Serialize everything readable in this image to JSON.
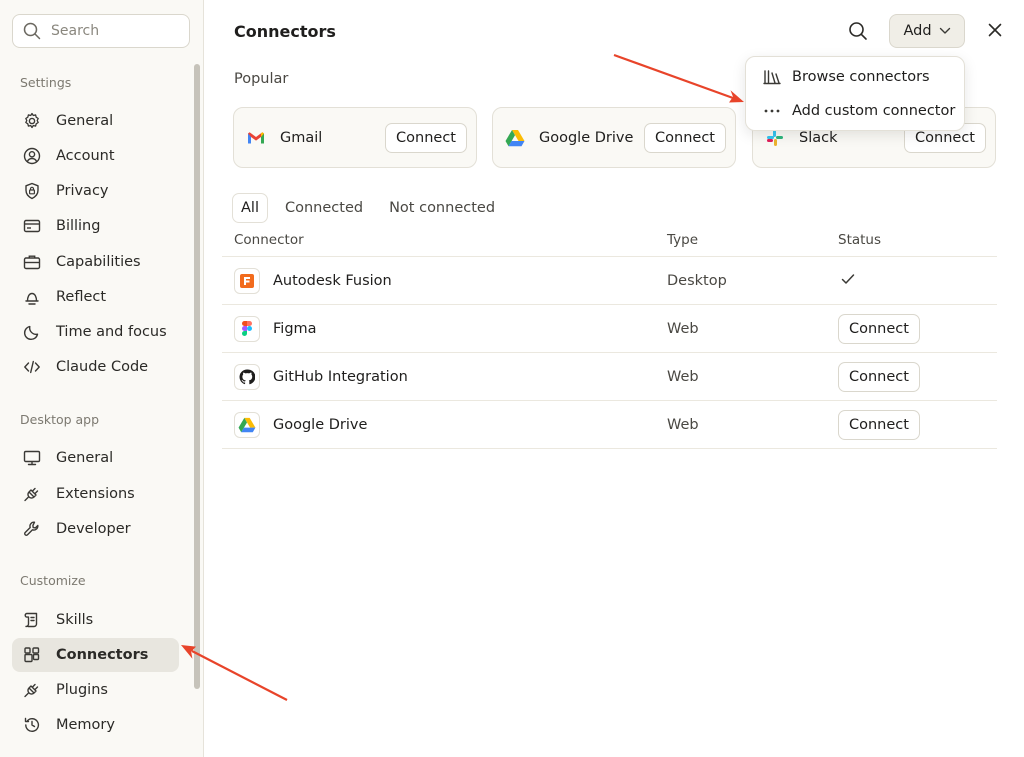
{
  "sidebar": {
    "search_placeholder": "Search",
    "sections": {
      "settings": "Settings",
      "desktop": "Desktop app",
      "customize": "Customize"
    },
    "settings_items": [
      {
        "label": "General",
        "icon": "gear-icon"
      },
      {
        "label": "Account",
        "icon": "user-circle-icon"
      },
      {
        "label": "Privacy",
        "icon": "shield-lock-icon"
      },
      {
        "label": "Billing",
        "icon": "credit-card-icon"
      },
      {
        "label": "Capabilities",
        "icon": "briefcase-icon"
      },
      {
        "label": "Reflect",
        "icon": "bell-icon"
      },
      {
        "label": "Time and focus",
        "icon": "moon-icon"
      },
      {
        "label": "Claude Code",
        "icon": "code-icon"
      }
    ],
    "desktop_items": [
      {
        "label": "General",
        "icon": "monitor-icon"
      },
      {
        "label": "Extensions",
        "icon": "plug-icon"
      },
      {
        "label": "Developer",
        "icon": "wrench-icon"
      }
    ],
    "customize_items": [
      {
        "label": "Skills",
        "icon": "scroll-icon"
      },
      {
        "label": "Connectors",
        "icon": "connectors-icon",
        "active": true
      },
      {
        "label": "Plugins",
        "icon": "plug-icon"
      },
      {
        "label": "Memory",
        "icon": "history-icon"
      }
    ]
  },
  "header": {
    "title": "Connectors",
    "add_label": "Add"
  },
  "add_menu": {
    "items": [
      {
        "label": "Browse connectors",
        "icon": "library-icon"
      },
      {
        "label": "Add custom connector",
        "icon": "more-dots-icon"
      }
    ]
  },
  "popular": {
    "label": "Popular",
    "cards": [
      {
        "name": "Gmail",
        "button": "Connect",
        "icon": "gmail-icon"
      },
      {
        "name": "Google Drive",
        "button": "Connect",
        "icon": "google-drive-icon"
      },
      {
        "name": "Slack",
        "button": "Connect",
        "icon": "slack-icon"
      }
    ]
  },
  "tabs": [
    "All",
    "Connected",
    "Not connected"
  ],
  "table": {
    "headers": {
      "connector": "Connector",
      "type": "Type",
      "status": "Status"
    },
    "rows": [
      {
        "name": "Autodesk Fusion",
        "type": "Desktop",
        "status": "connected",
        "icon": "autodesk-fusion-icon"
      },
      {
        "name": "Figma",
        "type": "Web",
        "status": "Connect",
        "icon": "figma-icon"
      },
      {
        "name": "GitHub Integration",
        "type": "Web",
        "status": "Connect",
        "icon": "github-icon"
      },
      {
        "name": "Google Drive",
        "type": "Web",
        "status": "Connect",
        "icon": "google-drive-icon"
      }
    ]
  },
  "colors": {
    "sidebar_bg": "#faf9f5",
    "active_item_bg": "#e8e6df",
    "annotation_arrow": "#e8442a",
    "fusion_orange": "#f26b1d"
  }
}
